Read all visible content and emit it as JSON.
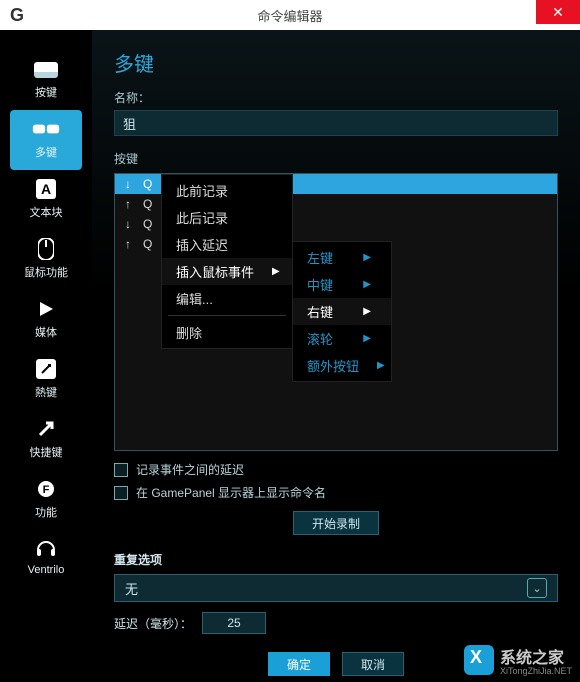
{
  "window": {
    "logo": "G",
    "title": "命令编辑器",
    "close": "✕"
  },
  "sidebar": {
    "items": [
      {
        "label": "按键"
      },
      {
        "label": "多键"
      },
      {
        "label": "文本块"
      },
      {
        "label": "鼠标功能"
      },
      {
        "label": "媒体"
      },
      {
        "label": "熱键"
      },
      {
        "label": "快捷键"
      },
      {
        "label": "功能"
      },
      {
        "label": "Ventrilo"
      }
    ]
  },
  "main": {
    "heading": "多键",
    "name_label": "名称：",
    "name_value": "狙",
    "keys_label": "按键",
    "key_rows": [
      {
        "dir": "↓",
        "key": "Q"
      },
      {
        "dir": "↑",
        "key": "Q"
      },
      {
        "dir": "↓",
        "key": "Q"
      },
      {
        "dir": "↑",
        "key": "Q"
      }
    ],
    "context_menu": {
      "items": [
        {
          "label": "此前记录"
        },
        {
          "label": "此后记录"
        },
        {
          "label": "插入延迟"
        },
        {
          "label": "插入鼠标事件",
          "has_sub": true,
          "highlight": true
        },
        {
          "label": "编辑..."
        },
        {
          "label": "删除"
        }
      ],
      "submenu": [
        {
          "label": "左键",
          "has_sub": true
        },
        {
          "label": "中键",
          "has_sub": true
        },
        {
          "label": "右键",
          "has_sub": true,
          "highlight": true
        },
        {
          "label": "滚轮",
          "has_sub": true
        },
        {
          "label": "额外按钮",
          "has_sub": true
        }
      ]
    },
    "check_record_delay": "记录事件之间的延迟",
    "check_gamepanel": "在 GamePanel 显示器上显示命令名",
    "start_record": "开始录制",
    "repeat_section": "重复选项",
    "repeat_value": "无",
    "delay_label": "延迟（毫秒）：",
    "delay_value": "25",
    "ok": "确定",
    "cancel": "取消"
  },
  "watermark": {
    "text": "系统之家",
    "sub": "XiTongZhiJia.NET"
  }
}
